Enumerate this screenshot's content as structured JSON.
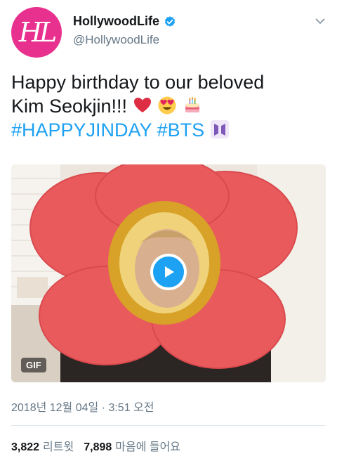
{
  "header": {
    "avatar_text": "HL",
    "display_name": "HollywoodLife",
    "handle": "@HollywoodLife",
    "verified_icon": "verified-badge-icon",
    "menu_icon": "chevron-down-icon"
  },
  "tweet": {
    "text_line1": "Happy birthday to our beloved",
    "text_line2": "Kim Seokjin!!!",
    "hashtag1": "#HAPPYJINDAY",
    "hashtag2": "#BTS",
    "emojis": [
      "red-heart",
      "heart-eyes-face",
      "birthday-cake",
      "bts-logo"
    ]
  },
  "media": {
    "badge": "GIF",
    "play_icon": "play-icon"
  },
  "meta": {
    "timestamp": "2018년 12월 04일 · 3:51 오전"
  },
  "stats": {
    "retweets_count": "3,822",
    "retweets_label": "리트윗",
    "likes_count": "7,898",
    "likes_label": "마음에 들어요"
  },
  "colors": {
    "brand_pink": "#e8318f",
    "link_blue": "#1da1f2",
    "muted_gray": "#657786",
    "flower_red": "#e95a5d"
  }
}
